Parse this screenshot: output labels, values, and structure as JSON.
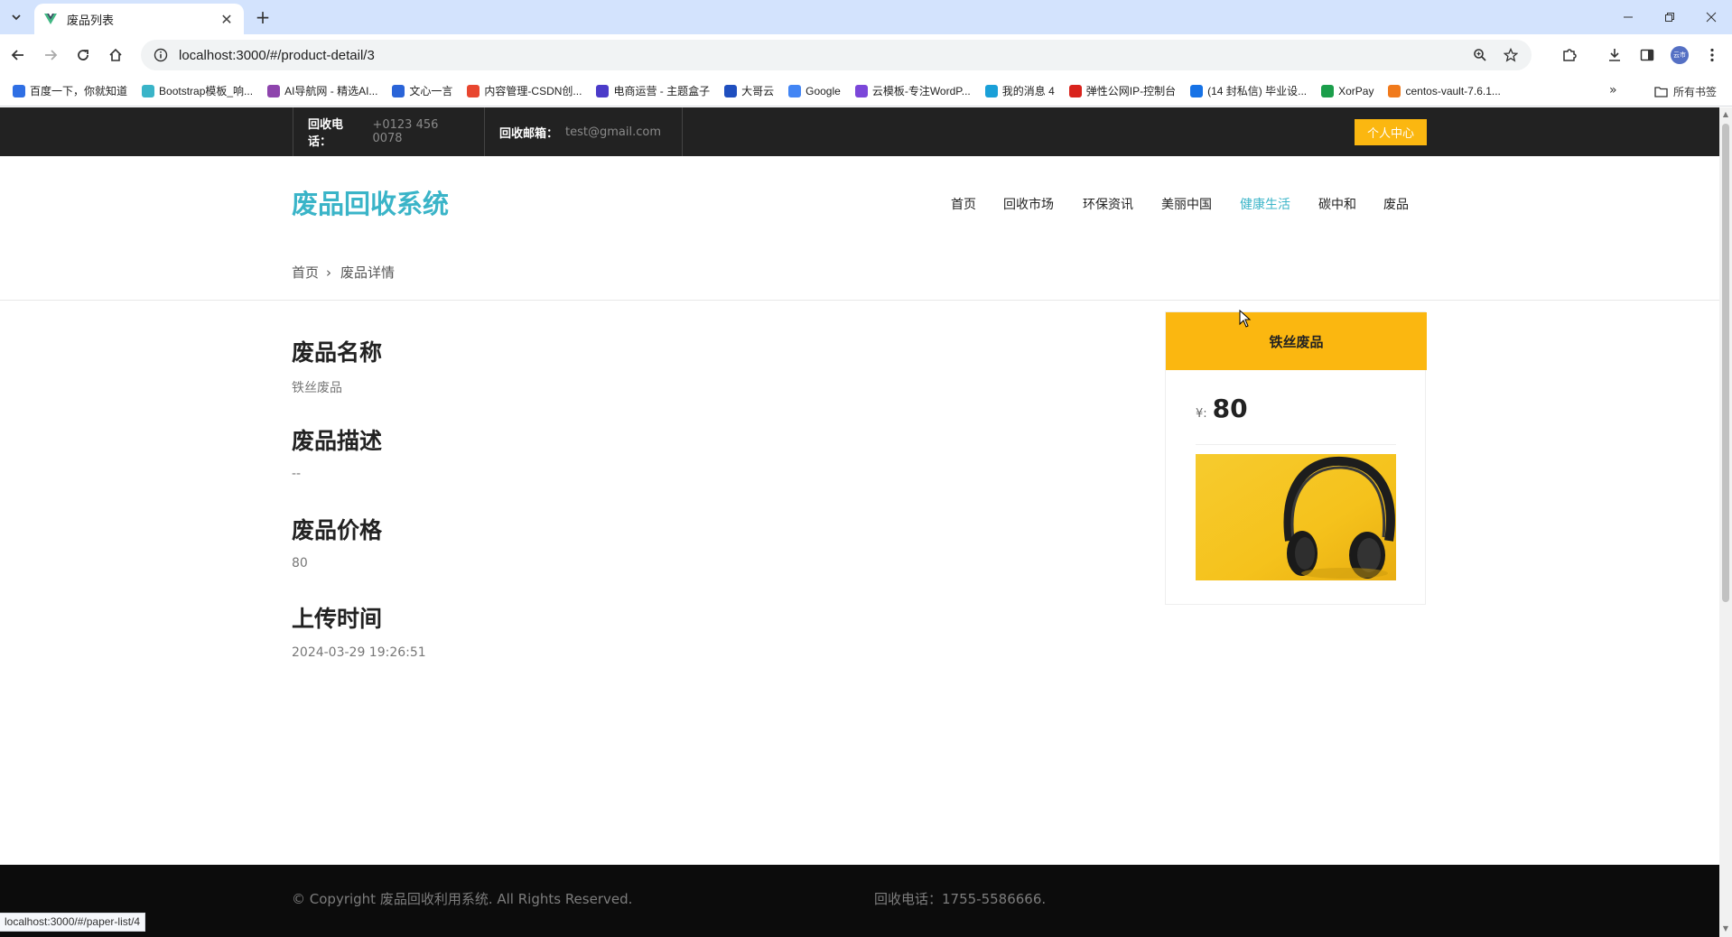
{
  "browser": {
    "tab_title": "废品列表",
    "url": "localhost:3000/#/product-detail/3",
    "status_url": "localhost:3000/#/paper-list/4",
    "bookmarks": [
      {
        "label": "百度一下，你就知道",
        "color": "#2f6fe4"
      },
      {
        "label": "Bootstrap模板_响...",
        "color": "#3ab4c8"
      },
      {
        "label": "AI导航网 - 精选AI...",
        "color": "#8e44ad"
      },
      {
        "label": "文心一言",
        "color": "#2a64d8"
      },
      {
        "label": "内容管理-CSDN创...",
        "color": "#e8462f"
      },
      {
        "label": "电商运营 - 主题盒子",
        "color": "#4b3bc9"
      },
      {
        "label": "大哥云",
        "color": "#1f4fbf"
      },
      {
        "label": "Google",
        "color": "#4285f4"
      },
      {
        "label": "云模板-专注WordP...",
        "color": "#7b47d9"
      },
      {
        "label": "我的消息 4",
        "color": "#1aa0d8"
      },
      {
        "label": "弹性公网IP-控制台",
        "color": "#d9231c"
      },
      {
        "label": "(14 封私信) 毕业设...",
        "color": "#1672e6"
      },
      {
        "label": "XorPay",
        "color": "#1b9e4b"
      },
      {
        "label": "centos-vault-7.6.1...",
        "color": "#f07a1c"
      }
    ],
    "all_bookmarks": "所有书签",
    "avatar_text": "云市"
  },
  "topbar": {
    "phone_label": "回收电话：",
    "phone_value": "+0123 456 0078",
    "email_label": "回收邮箱：",
    "email_value": "test@gmail.com",
    "user_center": "个人中心"
  },
  "site": {
    "logo": "废品回收系统",
    "nav": [
      "首页",
      "回收市场",
      "环保资讯",
      "美丽中国",
      "健康生活",
      "碳中和",
      "废品"
    ],
    "active_nav": "健康生活"
  },
  "breadcrumb": {
    "home": "首页",
    "separator": "›",
    "current": "废品详情"
  },
  "detail": {
    "name_title": "废品名称",
    "name_value": "铁丝废品",
    "desc_title": "废品描述",
    "desc_value": "--",
    "price_title": "废品价格",
    "price_value": "80",
    "time_title": "上传时间",
    "time_value": "2024-03-29 19:26:51"
  },
  "card": {
    "title": "铁丝废品",
    "currency": "¥:",
    "price": "80",
    "image_icon": "headphones-image"
  },
  "footer": {
    "copyright": "© Copyright 废品回收利用系统. All Rights Reserved.",
    "phone": "回收电话：1755-5586666."
  },
  "colors": {
    "accent": "#3ab4c8",
    "yellow": "#fbb710",
    "dark": "#222222"
  }
}
